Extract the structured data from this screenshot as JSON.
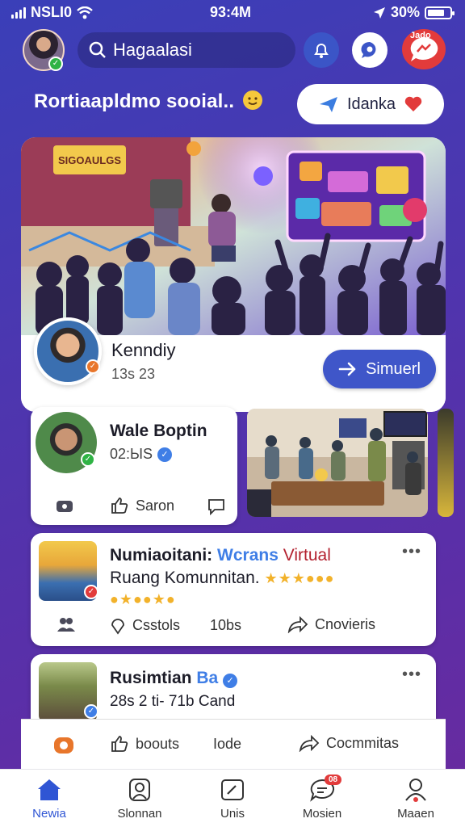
{
  "status_bar": {
    "carrier": "NSLI0",
    "time": "93:4M",
    "battery": "30%"
  },
  "header": {
    "search_text": "Hagaalasi",
    "notification_badge": "",
    "messenger_label": "Jado"
  },
  "tagline": "Rortiaapldmo sooial..",
  "join_button": {
    "label": "Idanka"
  },
  "hero": {
    "user_name": "Kenndiy",
    "user_meta": "13s 23",
    "primary_button": "Simuerl",
    "art_labels": {
      "stage_sign": "SIGOAULGS"
    }
  },
  "story_card": {
    "name": "Wale Boptin",
    "meta": "02:ЫS",
    "action_label": "Saron"
  },
  "posts": [
    {
      "title_a": "Numiaoitani:",
      "title_b": "Wcrans",
      "title_c": "Virtual",
      "subtitle": "Ruang Komunnitan.",
      "actions": {
        "a": "Csstols",
        "b": "10bs",
        "c": "Cnovieris"
      }
    },
    {
      "title_a": "Rusimtian",
      "title_b": "Ba",
      "subtitle": "28s 2 ti- 71b Cand"
    }
  ],
  "bottom_strip": {
    "a": "boouts",
    "b": "Iode",
    "c": "Cocmmitas"
  },
  "tabs": [
    {
      "label": "Newia"
    },
    {
      "label": "Slonnan"
    },
    {
      "label": "Unis",
      "badge": ""
    },
    {
      "label": "Mosien",
      "badge": "08"
    },
    {
      "label": "Maaen"
    }
  ],
  "colors": {
    "primary": "#3f56c9",
    "accent_red": "#e23b3b",
    "online": "#2fb344",
    "verified": "#3f7ee6"
  }
}
